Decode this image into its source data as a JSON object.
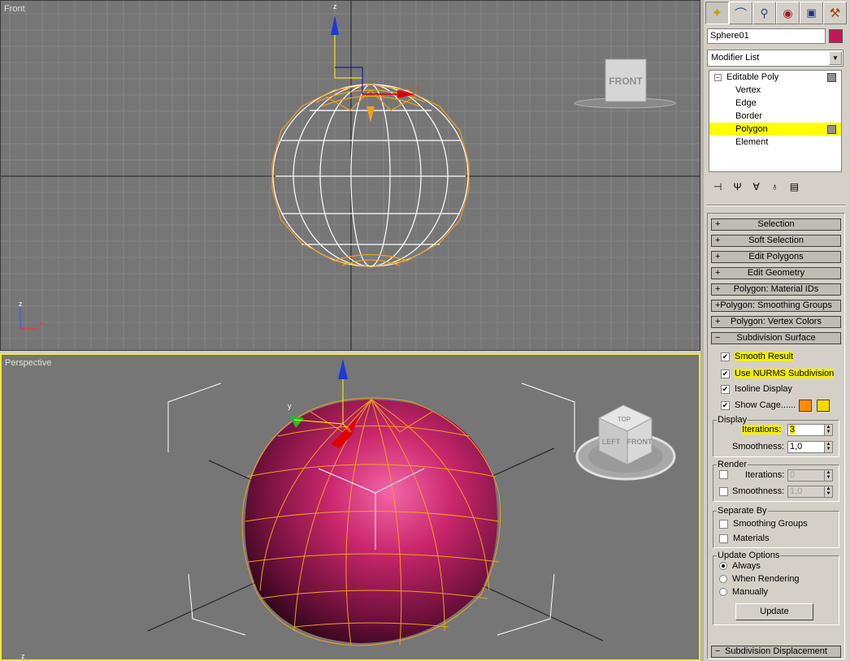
{
  "viewports": {
    "front_label": "Front",
    "perspective_label": "Perspective",
    "viewcube_front": "FRONT",
    "viewcube_top": "TOP",
    "viewcube_left": "LEFT",
    "axis_z": "z",
    "axis_x": "x",
    "axis_y": "y"
  },
  "panel": {
    "object_name": "Sphere01",
    "object_color": "#c2185b",
    "modifier_list": "Modifier List",
    "stack": [
      {
        "label": "Editable Poly",
        "expanded": true
      },
      {
        "label": "Vertex"
      },
      {
        "label": "Edge"
      },
      {
        "label": "Border"
      },
      {
        "label": "Polygon",
        "selected": true
      },
      {
        "label": "Element"
      }
    ],
    "rollouts": [
      "Selection",
      "Soft Selection",
      "Edit Polygons",
      "Edit Geometry",
      "Polygon: Material IDs",
      "Polygon: Smoothing Groups",
      "Polygon: Vertex Colors",
      "Subdivision Surface"
    ],
    "subdivision": {
      "smooth_result": "Smooth Result",
      "use_nurms": "Use NURMS Subdivision",
      "isoline": "Isoline Display",
      "show_cage": "Show Cage......",
      "display_group": "Display",
      "iterations_label": "Iterations:",
      "iterations_value": "3",
      "smoothness_label": "Smoothness:",
      "smoothness_value": "1,0",
      "render_group": "Render",
      "render_iterations_value": "0",
      "render_smoothness_value": "1,0",
      "separate_group": "Separate By",
      "smoothing_groups": "Smoothing Groups",
      "materials": "Materials",
      "update_group": "Update Options",
      "always": "Always",
      "when_rendering": "When Rendering",
      "manually": "Manually",
      "update_button": "Update"
    },
    "last_rollout": "Subdivision Displacement",
    "cage_color_1": "#ff8c00",
    "cage_color_2": "#ffd700"
  }
}
